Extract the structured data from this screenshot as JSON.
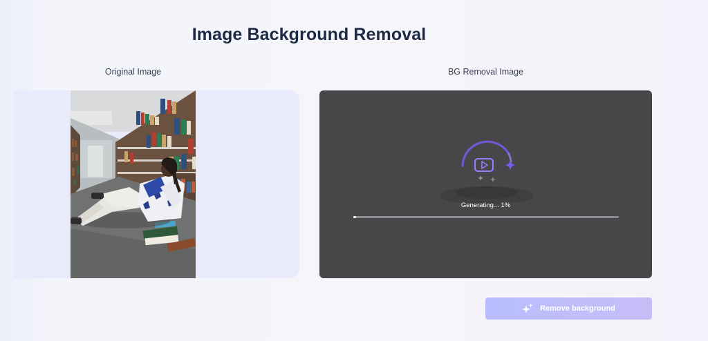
{
  "page": {
    "title": "Image Background Removal"
  },
  "original": {
    "label": "Original Image"
  },
  "result": {
    "label": "BG Removal Image",
    "status_text": "Generating... 1%",
    "progress": 0.01
  },
  "actions": {
    "remove_background_label": "Remove background",
    "icon": "sparkle-icon"
  },
  "colors": {
    "accent": "#7c5cf0",
    "result_bg": "#474749",
    "button_gradient_start": "#b8bdfd",
    "button_gradient_end": "#c6bdf7"
  }
}
